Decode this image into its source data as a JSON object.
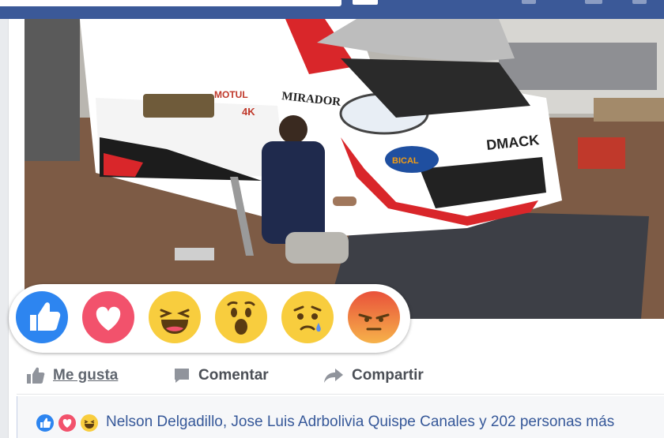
{
  "post": {
    "photo_alt": "",
    "car_decals": {
      "sponsor_side": "MIRADOR",
      "sponsor_front": "DMACK",
      "sponsor_badge": "BICAL",
      "motul": "MOTUL",
      "accent_number": "4K"
    }
  },
  "reactions": [
    {
      "name": "like",
      "color": "#2d85f0"
    },
    {
      "name": "love",
      "color": "#f2526c"
    },
    {
      "name": "haha",
      "color": "#f8cd3e"
    },
    {
      "name": "wow",
      "color": "#f8cd3e"
    },
    {
      "name": "sad",
      "color": "#f8cd3e"
    },
    {
      "name": "angry",
      "color": "#f0693a"
    }
  ],
  "actions": {
    "like_label": "Me gusta",
    "comment_label": "Comentar",
    "share_label": "Compartir"
  },
  "summary": {
    "text": "Nelson Delgadillo, Jose Luis Adrbolivia Quispe Canales y 202 personas más"
  },
  "colors": {
    "topbar": "#3b5998",
    "link": "#365899",
    "action_text": "#4b4f56"
  },
  "icons": {
    "like": "thumbs-up-icon",
    "comment": "comment-bubble-icon",
    "share": "share-arrow-icon"
  }
}
